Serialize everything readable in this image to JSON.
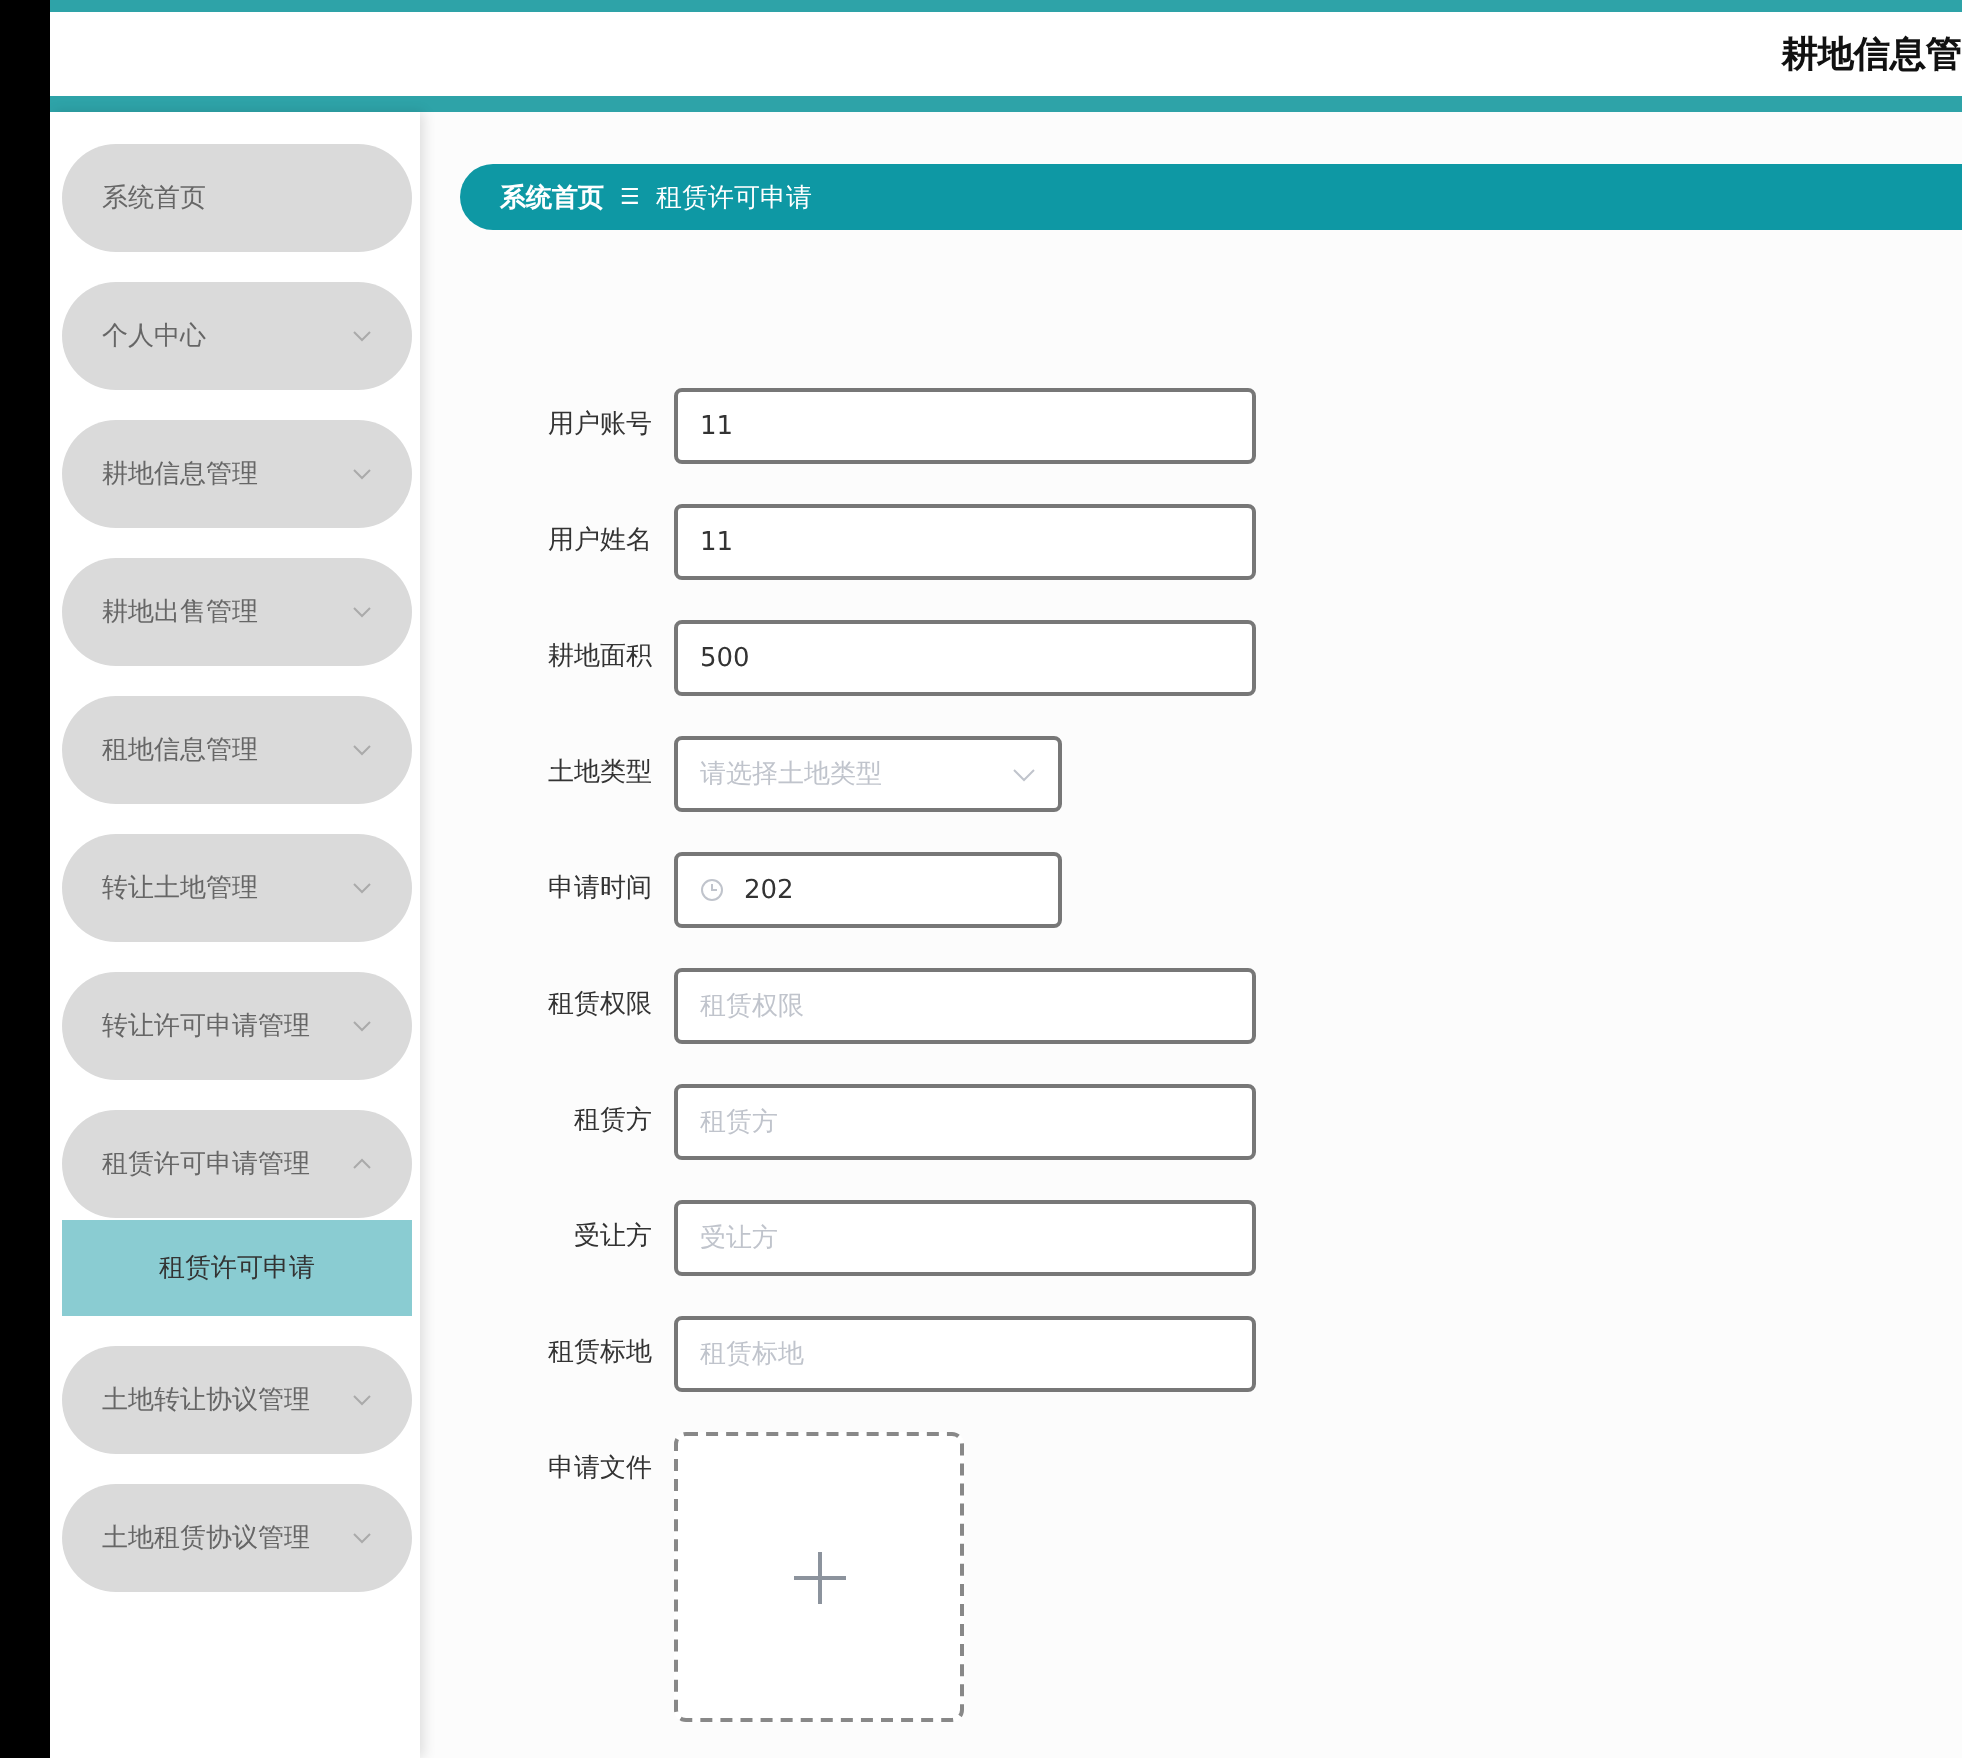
{
  "header": {
    "title": "耕地信息管"
  },
  "sidebar": {
    "items": [
      {
        "label": "系统首页",
        "kind": "link"
      },
      {
        "label": "个人中心",
        "kind": "menu",
        "expanded": false
      },
      {
        "label": "耕地信息管理",
        "kind": "menu",
        "expanded": false
      },
      {
        "label": "耕地出售管理",
        "kind": "menu",
        "expanded": false
      },
      {
        "label": "租地信息管理",
        "kind": "menu",
        "expanded": false
      },
      {
        "label": "转让土地管理",
        "kind": "menu",
        "expanded": false
      },
      {
        "label": "转让许可申请管理",
        "kind": "menu",
        "expanded": false
      },
      {
        "label": "租赁许可申请管理",
        "kind": "menu",
        "expanded": true,
        "children": [
          {
            "label": "租赁许可申请",
            "selected": true
          }
        ]
      },
      {
        "label": "土地转让协议管理",
        "kind": "menu",
        "expanded": false
      },
      {
        "label": "土地租赁协议管理",
        "kind": "menu",
        "expanded": false
      }
    ]
  },
  "breadcrumb": {
    "items": [
      "系统首页",
      "租赁许可申请"
    ],
    "separator": "☰"
  },
  "form": {
    "fields": [
      {
        "label": "用户账号",
        "kind": "text",
        "value": "11"
      },
      {
        "label": "用户姓名",
        "kind": "text",
        "value": "11"
      },
      {
        "label": "耕地面积",
        "kind": "text",
        "value": "500"
      },
      {
        "label": "土地类型",
        "kind": "select",
        "placeholder": "请选择土地类型"
      },
      {
        "label": "申请时间",
        "kind": "date",
        "value": "202"
      },
      {
        "label": "租赁权限",
        "kind": "text",
        "placeholder": "租赁权限"
      },
      {
        "label": "租赁方",
        "kind": "text",
        "placeholder": "租赁方"
      },
      {
        "label": "受让方",
        "kind": "text",
        "placeholder": "受让方"
      },
      {
        "label": "租赁标地",
        "kind": "text",
        "placeholder": "租赁标地"
      },
      {
        "label": "申请文件",
        "kind": "upload"
      }
    ]
  }
}
